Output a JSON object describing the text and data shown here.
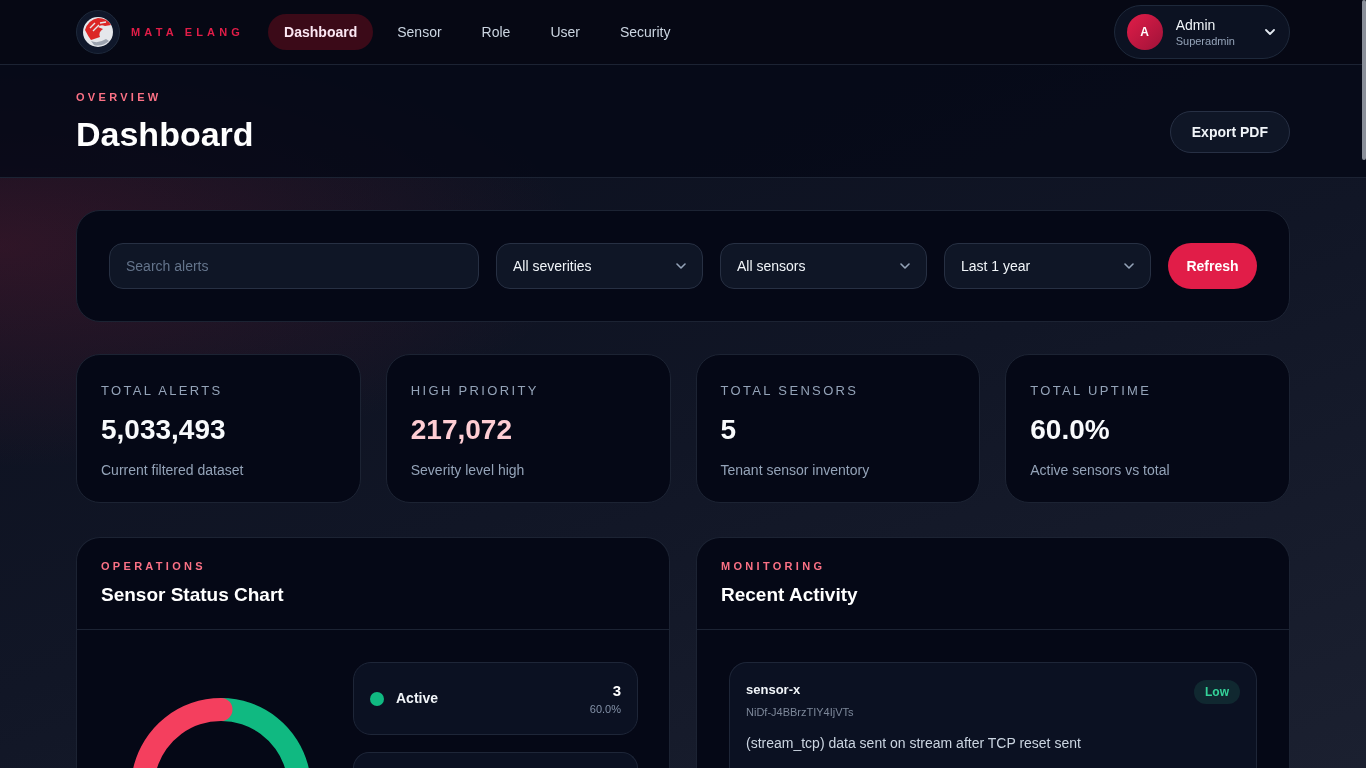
{
  "brand": {
    "name": "MATA ELANG"
  },
  "nav": [
    {
      "label": "Dashboard",
      "selected": true
    },
    {
      "label": "Sensor",
      "selected": false
    },
    {
      "label": "Role",
      "selected": false
    },
    {
      "label": "User",
      "selected": false
    },
    {
      "label": "Security",
      "selected": false
    }
  ],
  "user_menu": {
    "initial": "A",
    "name": "Admin",
    "role": "Superadmin"
  },
  "page_header": {
    "eyebrow": "OVERVIEW",
    "title": "Dashboard",
    "export_button": "Export PDF"
  },
  "filters": {
    "search": {
      "placeholder": "Search alerts"
    },
    "selects": [
      {
        "value": "All severities"
      },
      {
        "value": "All sensors"
      },
      {
        "value": "Last 1 year"
      }
    ],
    "refresh_button": "Refresh"
  },
  "stats": [
    {
      "label": "TOTAL ALERTS",
      "value": "5,033,493",
      "note": "Current filtered dataset",
      "color": "#f8fafc"
    },
    {
      "label": "HIGH PRIORITY",
      "value": "217,072",
      "note": "Severity level high",
      "color": "#fecdd3"
    },
    {
      "label": "TOTAL SENSORS",
      "value": "5",
      "note": "Tenant sensor inventory",
      "color": "#f8fafc"
    },
    {
      "label": "TOTAL UPTIME",
      "value": "60.0%",
      "note": "Active sensors vs total",
      "color": "#f8fafc"
    }
  ],
  "sensor_status": {
    "eyebrow": "OPERATIONS",
    "title": "Sensor Status Chart",
    "legend": [
      {
        "label": "Active",
        "count": "3",
        "share": "60.0%",
        "color": "#10b981"
      }
    ]
  },
  "recent_activity": {
    "eyebrow": "MONITORING",
    "title": "Recent Activity",
    "items": [
      {
        "sensor": "sensor-x",
        "id": "NiDf-J4BBrzTIY4IjVTs",
        "severity": "Low",
        "color": "#34d399",
        "message": "(stream_tcp) data sent on stream after TCP reset sent"
      }
    ]
  }
}
